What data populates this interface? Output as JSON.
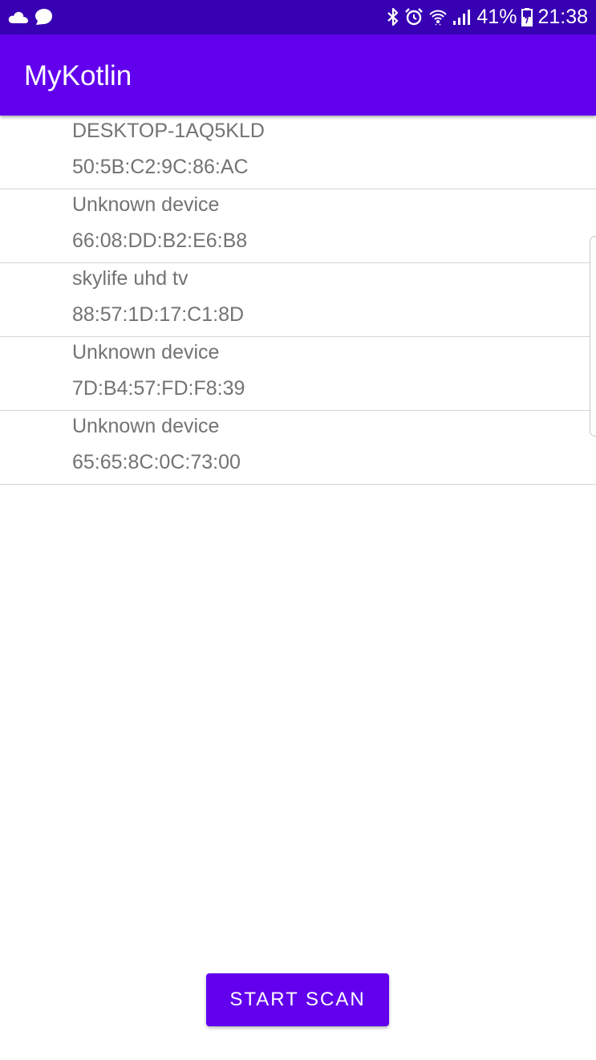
{
  "status_bar": {
    "left_icons": [
      "cloud-icon",
      "notification-bubble-icon"
    ],
    "right_icons": [
      "bluetooth-icon",
      "alarm-icon",
      "wifi-icon",
      "signal-icon"
    ],
    "battery_percent": "41%",
    "battery_icon": "battery-icon",
    "time": "21:38"
  },
  "app_bar": {
    "title": "MyKotlin"
  },
  "devices": [
    {
      "name": "DESKTOP-1AQ5KLD",
      "mac": "50:5B:C2:9C:86:AC"
    },
    {
      "name": "Unknown device",
      "mac": "66:08:DD:B2:E6:B8"
    },
    {
      "name": "skylife uhd tv",
      "mac": "88:57:1D:17:C1:8D"
    },
    {
      "name": "Unknown device",
      "mac": "7D:B4:57:FD:F8:39"
    },
    {
      "name": "Unknown device",
      "mac": "65:65:8C:0C:73:00"
    }
  ],
  "scan_button": {
    "label": "START SCAN"
  },
  "colors": {
    "status_bar": "#3700b3",
    "primary": "#6200ee",
    "list_text": "#737373",
    "divider": "#d6d6d6"
  }
}
